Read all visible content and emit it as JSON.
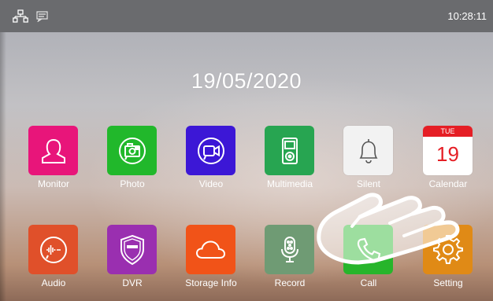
{
  "status_bar": {
    "time": "10:28:11",
    "left_icons": [
      "network-icon",
      "message-icon"
    ]
  },
  "home": {
    "date": "19/05/2020"
  },
  "apps_row1": [
    {
      "label": "Monitor",
      "icon": "person-outline-icon",
      "color": "#e8157a"
    },
    {
      "label": "Photo",
      "icon": "photo-icon",
      "color": "#21b82b"
    },
    {
      "label": "Video",
      "icon": "video-camera-icon",
      "color": "#3c17d6"
    },
    {
      "label": "Multimedia",
      "icon": "media-player-icon",
      "color": "#27a551"
    },
    {
      "label": "Silent",
      "icon": "bell-icon",
      "color": "#f2f2f2"
    },
    {
      "label": "Calendar",
      "icon": "calendar-icon",
      "color": "#ffffff",
      "weekday": "TUE",
      "day": "19"
    }
  ],
  "apps_row2": [
    {
      "label": "Audio",
      "icon": "audio-wave-icon",
      "color": "#e0502a"
    },
    {
      "label": "DVR",
      "icon": "shield-icon",
      "color": "#9a2fb0"
    },
    {
      "label": "Storage Info",
      "icon": "cloud-icon",
      "color": "#f15318"
    },
    {
      "label": "Record",
      "icon": "microphone-icon",
      "color": "#6f9b74"
    },
    {
      "label": "Call",
      "icon": "phone-icon",
      "color": "#27b52b"
    },
    {
      "label": "Setting",
      "icon": "gear-icon",
      "color": "#e08a16"
    }
  ],
  "overlay": {
    "icon": "pointing-hand-icon"
  }
}
